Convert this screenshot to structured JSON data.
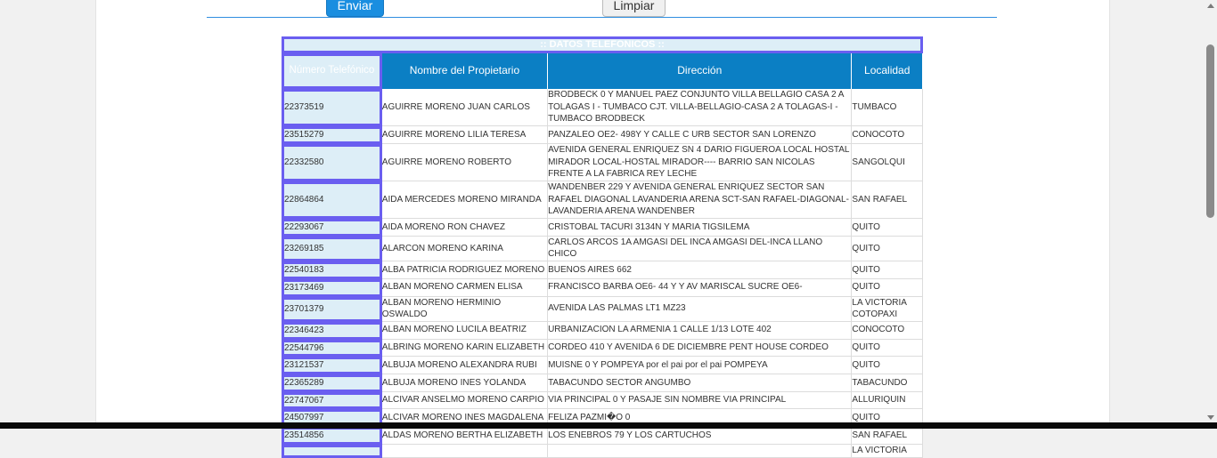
{
  "form": {
    "send_label": "Enviar",
    "clear_label": "Limpiar"
  },
  "table": {
    "title": ":: DATOS TELEFONICOS ::",
    "headers": [
      "Número Telefónico",
      "Nombre del Propietario",
      "Dirección",
      "Localidad"
    ],
    "rows": [
      {
        "num": "22373519",
        "owner": "AGUIRRE MORENO JUAN CARLOS",
        "addr": "BRODBECK 0 Y MANUEL PAEZ CONJUNTO VILLA BELLAGIO CASA 2 A TOLAGAS I - TUMBACO CJT. VILLA-BELLAGIO-CASA 2 A TOLAGAS-I - TUMBACO BRODBECK",
        "loc": "TUMBACO"
      },
      {
        "num": "23515279",
        "owner": "AGUIRRE MORENO LILIA TERESA",
        "addr": "PANZALEO OE2- 498Y Y CALLE C URB SECTOR SAN LORENZO",
        "loc": "CONOCOTO"
      },
      {
        "num": "22332580",
        "owner": "AGUIRRE MORENO ROBERTO",
        "addr": "AVENIDA GENERAL ENRIQUEZ SN 4 DARIO FIGUEROA LOCAL HOSTAL MIRADOR LOCAL-HOSTAL MIRADOR---- BARRIO SAN NICOLAS FRENTE A LA FABRICA REY LECHE",
        "loc": "SANGOLQUI"
      },
      {
        "num": "22864864",
        "owner": "AIDA MERCEDES MORENO MIRANDA",
        "addr": "WANDENBER 229 Y AVENIDA GENERAL ENRIQUEZ SECTOR SAN RAFAEL DIAGONAL LAVANDERIA ARENA SCT-SAN RAFAEL-DIAGONAL-LAVANDERIA ARENA WANDENBER",
        "loc": "SAN RAFAEL"
      },
      {
        "num": "22293067",
        "owner": "AIDA MORENO RON CHAVEZ",
        "addr": "CRISTOBAL TACURI 3134N Y MARIA TIGSILEMA",
        "loc": "QUITO"
      },
      {
        "num": "23269185",
        "owner": "ALARCON MORENO KARINA",
        "addr": "CARLOS ARCOS 1A AMGASI DEL INCA AMGASI DEL-INCA LLANO CHICO",
        "loc": "QUITO"
      },
      {
        "num": "22540183",
        "owner": "ALBA PATRICIA RODRIGUEZ MORENO",
        "addr": "BUENOS AIRES 662",
        "loc": "QUITO"
      },
      {
        "num": "23173469",
        "owner": "ALBAN MORENO CARMEN ELISA",
        "addr": "FRANCISCO BARBA OE6- 44 Y Y AV MARISCAL SUCRE OE6-",
        "loc": "QUITO"
      },
      {
        "num": "23701379",
        "owner": "ALBAN MORENO HERMINIO OSWALDO",
        "addr": "AVENIDA LAS PALMAS LT1 MZ23",
        "loc": "LA VICTORIA COTOPAXI"
      },
      {
        "num": "22346423",
        "owner": "ALBAN MORENO LUCILA BEATRIZ",
        "addr": "URBANIZACION LA ARMENIA 1 CALLE 1/13 LOTE 402",
        "loc": "CONOCOTO"
      },
      {
        "num": "22544796",
        "owner": "ALBRING MORENO KARIN ELIZABETH",
        "addr": "CORDEO 410 Y AVENIDA 6 DE DICIEMBRE PENT HOUSE CORDEO",
        "loc": "QUITO"
      },
      {
        "num": "23121537",
        "owner": "ALBUJA MORENO ALEXANDRA RUBI",
        "addr": "MUISNE 0 Y POMPEYA por el pai por el pai POMPEYA",
        "loc": "QUITO"
      },
      {
        "num": "22365289",
        "owner": "ALBUJA MORENO INES YOLANDA",
        "addr": "TABACUNDO SECTOR ANGUMBO",
        "loc": "TABACUNDO"
      },
      {
        "num": "22747067",
        "owner": "ALCIVAR ANSELMO MORENO CARPIO",
        "addr": "VIA PRINCIPAL 0 Y PASAJE SIN NOMBRE VIA PRINCIPAL",
        "loc": "ALLURIQUIN"
      },
      {
        "num": "24507997",
        "owner": "ALCIVAR MORENO INES MAGDALENA",
        "addr": "FELIZA PAZMI�O 0",
        "loc": "QUITO"
      },
      {
        "num": "23514856",
        "owner": "ALDAS MORENO BERTHA ELIZABETH",
        "addr": "LOS ENEBROS 79 Y LOS CARTUCHOS",
        "loc": "SAN RAFAEL"
      },
      {
        "num": "",
        "owner": "",
        "addr": "",
        "loc": "LA VICTORIA"
      }
    ]
  }
}
